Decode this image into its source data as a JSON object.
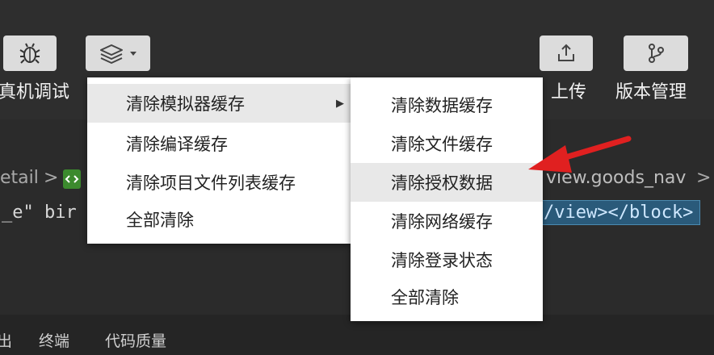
{
  "toolbar": {
    "debug_label": "真机调试",
    "upload_label": "上传",
    "version_label": "版本管理",
    "icons": {
      "debug": "bug-icon",
      "cache": "layers-icon",
      "dropdown": "caret-down-icon",
      "upload": "upload-icon",
      "version": "branch-icon"
    }
  },
  "breadcrumb": {
    "left_text": "etail",
    "separator": ">",
    "right_text": "view.goods_nav",
    "right_separator": ">"
  },
  "code": {
    "left_text": "_e\" bir",
    "right_text": "/view></block>"
  },
  "menu": {
    "items": [
      {
        "label": "清除模拟器缓存",
        "has_submenu": true,
        "selected": true
      },
      {
        "label": "清除编译缓存"
      },
      {
        "label": "清除项目文件列表缓存"
      },
      {
        "label": "全部清除"
      }
    ],
    "submenu_arrow": "▶"
  },
  "submenu": {
    "items": [
      {
        "label": "清除数据缓存"
      },
      {
        "label": "清除文件缓存"
      },
      {
        "label": "清除授权数据",
        "highlighted": true
      },
      {
        "label": "清除网络缓存"
      },
      {
        "label": "清除登录状态"
      },
      {
        "label": "全部清除"
      }
    ]
  },
  "bottom_tabs": [
    "出",
    "终端",
    "代码质量"
  ],
  "colors": {
    "annotation_arrow": "#e02020",
    "code_highlight": "#2a5a7a"
  }
}
